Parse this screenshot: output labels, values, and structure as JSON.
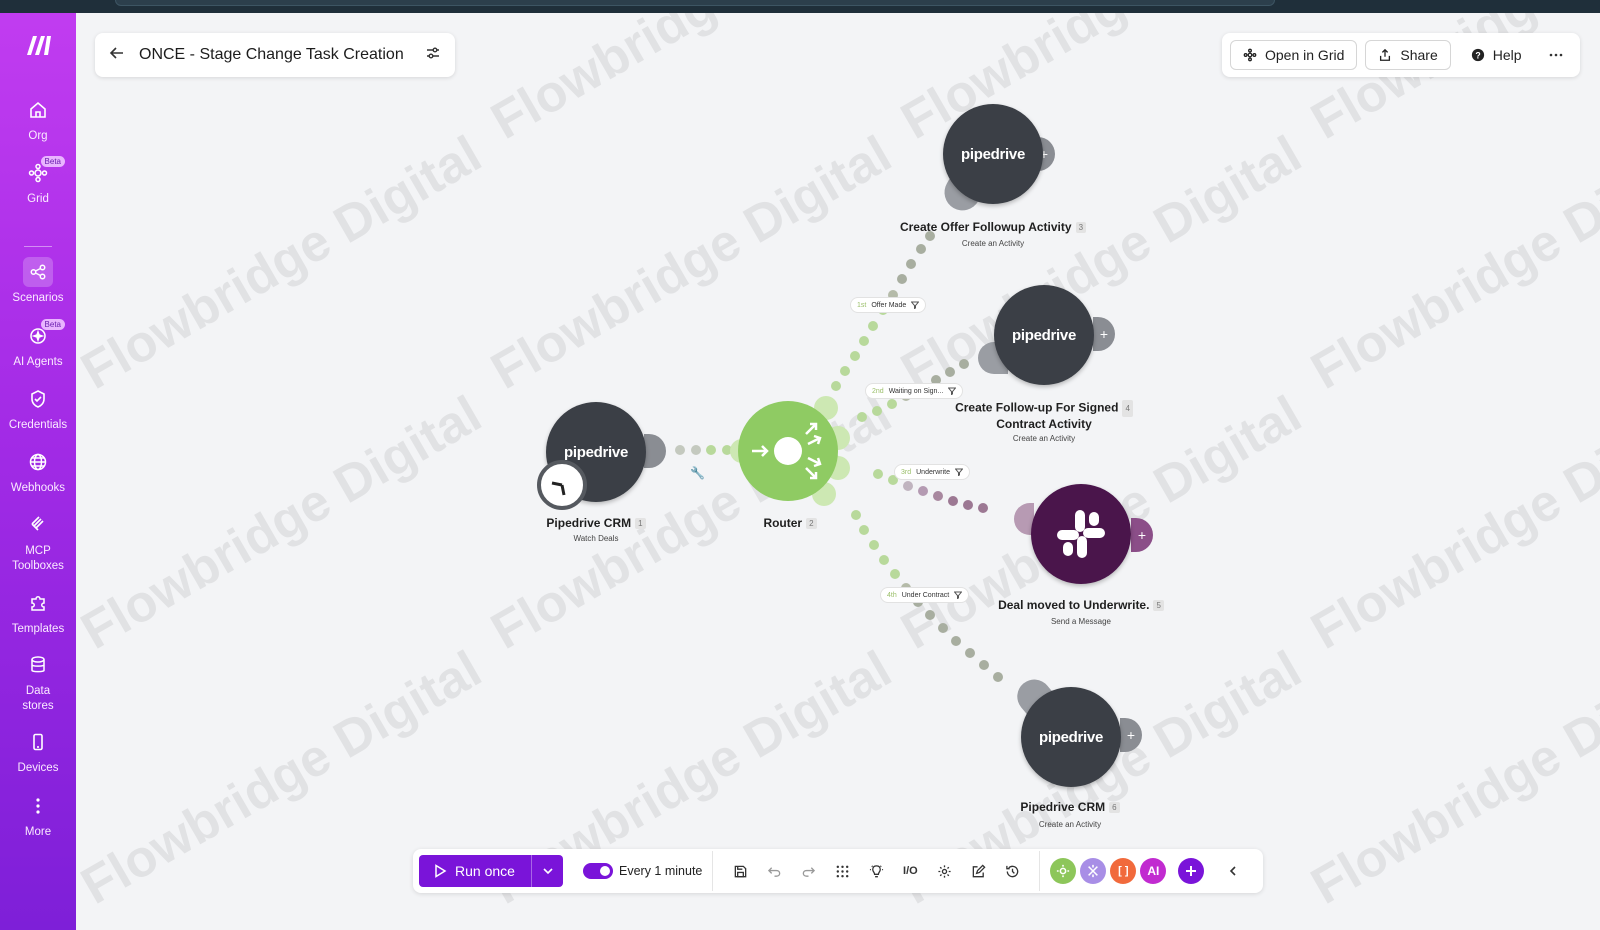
{
  "sidebar": {
    "items": [
      {
        "label": "Org",
        "icon": "home-icon"
      },
      {
        "label": "Grid",
        "icon": "grid-nodes-icon",
        "badge": "Beta"
      },
      {
        "label": "Scenarios",
        "icon": "share-nodes-icon",
        "active": true
      },
      {
        "label": "AI Agents",
        "icon": "sparkle-icon",
        "badge": "Beta"
      },
      {
        "label": "Credentials",
        "icon": "shield-icon"
      },
      {
        "label": "Webhooks",
        "icon": "globe-icon"
      },
      {
        "label": "MCP Toolboxes",
        "icon": "toolbox-icon"
      },
      {
        "label": "Templates",
        "icon": "puzzle-icon"
      },
      {
        "label": "Data stores",
        "icon": "database-icon"
      },
      {
        "label": "Devices",
        "icon": "phone-icon"
      },
      {
        "label": "More",
        "icon": "more-vertical-icon"
      }
    ]
  },
  "header": {
    "title": "ONCE - Stage Change Task Creation",
    "open_in_grid": "Open in Grid",
    "share": "Share",
    "help": "Help"
  },
  "watermark": "Flowbridge Digital",
  "nodes": {
    "trigger": {
      "brand": "pipedrive",
      "title": "Pipedrive CRM",
      "num": "1",
      "sub": "Watch Deals"
    },
    "router": {
      "title": "Router",
      "num": "2"
    },
    "offer": {
      "brand": "pipedrive",
      "title": "Create Offer Followup Activity",
      "num": "3",
      "sub": "Create an Activity"
    },
    "signed": {
      "brand": "pipedrive",
      "title_line1": "Create Follow-up For Signed",
      "title_line2": "Contract Activity",
      "num": "4",
      "sub": "Create an Activity"
    },
    "slack": {
      "title": "Deal moved to Underwrite.",
      "num": "5",
      "sub": "Send a Message"
    },
    "contract": {
      "brand": "pipedrive",
      "title": "Pipedrive CRM",
      "num": "6",
      "sub": "Create an Activity"
    }
  },
  "routes": [
    {
      "order": "1st",
      "label": "Offer Made"
    },
    {
      "order": "2nd",
      "label": "Waiting on Sign..."
    },
    {
      "order": "3rd",
      "label": "Underwrite"
    },
    {
      "order": "4th",
      "label": "Under Contract"
    }
  ],
  "toolbar": {
    "run_once": "Run once",
    "schedule": "Every 1 minute",
    "ai_label": "AI"
  },
  "colors": {
    "accent": "#7a14d9",
    "router": "#8fcb63",
    "pipedrive": "#3b3f46",
    "slack": "#4a154b"
  }
}
